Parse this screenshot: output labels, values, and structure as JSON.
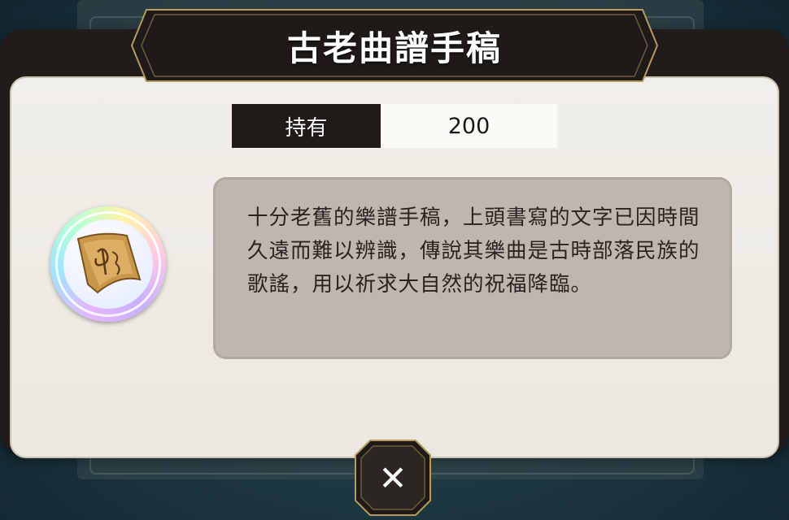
{
  "dialog": {
    "title": "古老曲譜手稿",
    "owned_label": "持有",
    "owned_value": "200",
    "description": "十分老舊的樂譜手稿，上頭書寫的文字已因時間久遠而難以辨識，傳說其樂曲是古時部落民族的歌謠，用以祈求大自然的祝福降臨。",
    "item_icon": "ancient-sheet-music-icon",
    "close_icon": "close-icon",
    "close_glyph": "✕"
  },
  "colors": {
    "frame": "#1f1c19",
    "body": "#f1efe9",
    "description_bg": "#c0b6b0",
    "gold_trim": "#b89a5e"
  }
}
